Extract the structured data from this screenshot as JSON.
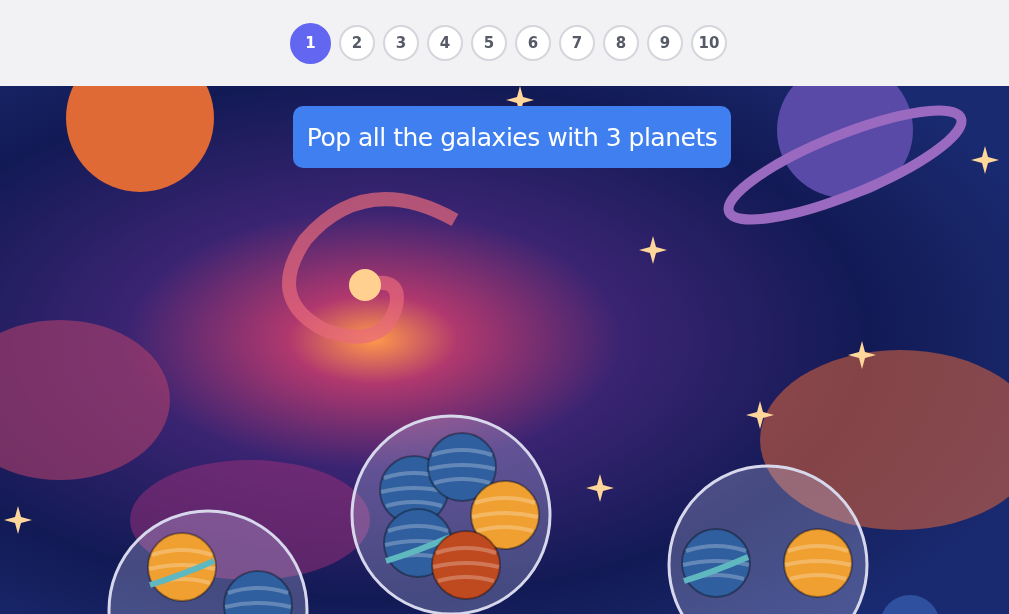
{
  "levels": [
    {
      "label": "1",
      "selected": true
    },
    {
      "label": "2",
      "selected": false
    },
    {
      "label": "3",
      "selected": false
    },
    {
      "label": "4",
      "selected": false
    },
    {
      "label": "5",
      "selected": false
    },
    {
      "label": "6",
      "selected": false
    },
    {
      "label": "7",
      "selected": false
    },
    {
      "label": "8",
      "selected": false
    },
    {
      "label": "9",
      "selected": false
    },
    {
      "label": "10",
      "selected": false
    }
  ],
  "prompt": "Pop all the galaxies with 3 planets",
  "galaxies": [
    {
      "planets": [
        {
          "color": "#f0a030",
          "ringed": true
        },
        {
          "color": "#2f5f9f",
          "ringed": false
        }
      ]
    },
    {
      "planets": [
        {
          "color": "#2f5f9f",
          "ringed": false
        },
        {
          "color": "#2f5f9f",
          "ringed": false
        },
        {
          "color": "#f0a030",
          "ringed": false
        },
        {
          "color": "#2f5f9f",
          "ringed": true
        },
        {
          "color": "#c04a20",
          "ringed": false
        }
      ]
    },
    {
      "planets": [
        {
          "color": "#2f5f9f",
          "ringed": true
        },
        {
          "color": "#f0a030",
          "ringed": false
        }
      ]
    }
  ]
}
